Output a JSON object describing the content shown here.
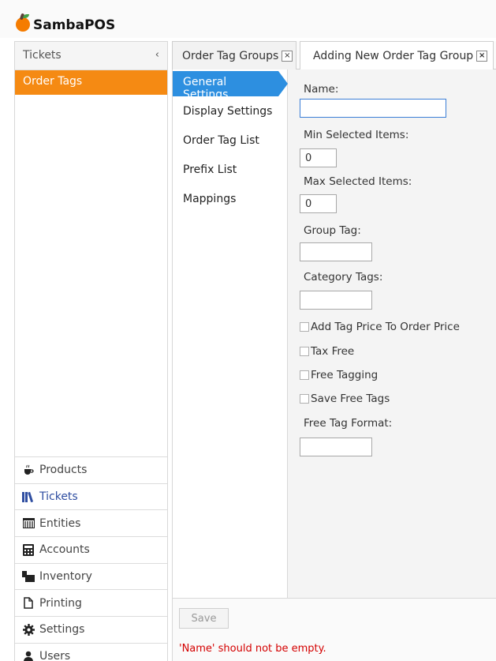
{
  "app": {
    "title": "SambaPOS"
  },
  "sidebar": {
    "header": "Tickets",
    "collapse_symbol": "‹",
    "active_item": "Order Tags",
    "modules": [
      {
        "label": "Products",
        "icon": "coffee-icon"
      },
      {
        "label": "Tickets",
        "icon": "books-icon",
        "active": true
      },
      {
        "label": "Entities",
        "icon": "table-icon"
      },
      {
        "label": "Accounts",
        "icon": "calculator-icon"
      },
      {
        "label": "Inventory",
        "icon": "inventory-icon"
      },
      {
        "label": "Printing",
        "icon": "document-icon"
      },
      {
        "label": "Settings",
        "icon": "gear-icon"
      },
      {
        "label": "Users",
        "icon": "user-icon"
      }
    ]
  },
  "tabs": [
    {
      "label": "Order Tag Groups",
      "close": "×"
    },
    {
      "label": "Adding New Order Tag Group",
      "close": "×",
      "selected": true
    }
  ],
  "settings_nav": [
    {
      "label": "General Settings",
      "active": true
    },
    {
      "label": "Display Settings"
    },
    {
      "label": "Order Tag List"
    },
    {
      "label": "Prefix List"
    },
    {
      "label": "Mappings"
    }
  ],
  "form": {
    "name_label": "Name:",
    "name_value": "",
    "min_label": "Min Selected Items:",
    "min_value": "0",
    "max_label": "Max Selected Items:",
    "max_value": "0",
    "group_tag_label": "Group Tag:",
    "group_tag_value": "",
    "category_tags_label": "Category Tags:",
    "category_tags_value": "",
    "add_tag_price_label": "Add Tag Price To Order Price",
    "tax_free_label": "Tax Free",
    "free_tagging_label": "Free Tagging",
    "save_free_tags_label": "Save Free Tags",
    "free_tag_format_label": "Free Tag Format:",
    "free_tag_format_value": ""
  },
  "actions": {
    "save_label": "Save",
    "error_message": "'Name' should not be empty."
  },
  "colors": {
    "accent_orange": "#f58a13",
    "accent_blue": "#2d8fe0",
    "error_red": "#d40000"
  }
}
